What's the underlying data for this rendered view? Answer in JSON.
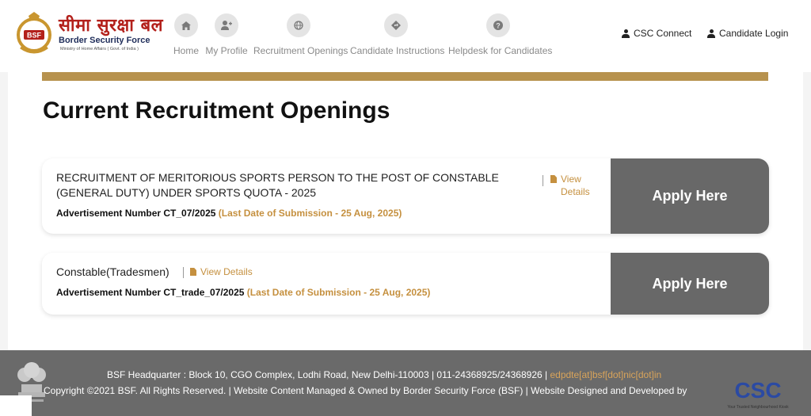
{
  "header": {
    "logo": {
      "hindi": "सीमा सुरक्षा बल",
      "name": "Border Security Force",
      "subtitle": "Ministry of Home Affairs ( Govt. of India )",
      "badge": "BSF"
    },
    "nav": [
      {
        "label": "Home",
        "icon": "home-icon"
      },
      {
        "label": "My Profile",
        "icon": "user-plus-icon"
      },
      {
        "label": "Recruitment Openings",
        "icon": "globe-icon"
      },
      {
        "label": "Candidate Instructions",
        "icon": "directions-icon"
      },
      {
        "label": "Helpdesk for Candidates",
        "icon": "question-icon"
      }
    ],
    "csc_connect": "CSC Connect",
    "candidate_login": "Candidate Login"
  },
  "main": {
    "title": "Current Recruitment Openings",
    "openings": [
      {
        "title": "RECRUITMENT OF MERITORIOUS SPORTS PERSON TO THE POST OF CONSTABLE (GENERAL DUTY) UNDER SPORTS QUOTA - 2025",
        "view_details": "View Details",
        "adv_label": "Advertisement Number CT_07/2025",
        "deadline": "(Last Date of Submission - 25 Aug, 2025)",
        "apply": "Apply Here"
      },
      {
        "title": "Constable(Tradesmen)",
        "view_details": "View Details",
        "adv_label": "Advertisement Number CT_trade_07/2025",
        "deadline": "(Last Date of Submission - 25 Aug, 2025)",
        "apply": "Apply Here"
      }
    ]
  },
  "footer": {
    "address": "BSF Headquarter : Block 10, CGO Complex, Lodhi Road, New Delhi-110003 | 011-24368925/24368926 | ",
    "email": "edpdte[at]bsf[dot]nic[dot]in",
    "copyright": "Copyright ©2021 BSF. All Rights Reserved. | Website Content Managed & Owned by Border Security Force (BSF) | Website Designed and Developed by",
    "csc_logo": "CSC",
    "csc_tagline": "Your Trusted Neighbourhood Kiosk"
  },
  "colors": {
    "gold": "#b7924e",
    "deadline": "#c5903f",
    "apply_bg": "#686868",
    "footer_bg": "#6a6a6a",
    "brand_red": "#b3201b"
  }
}
